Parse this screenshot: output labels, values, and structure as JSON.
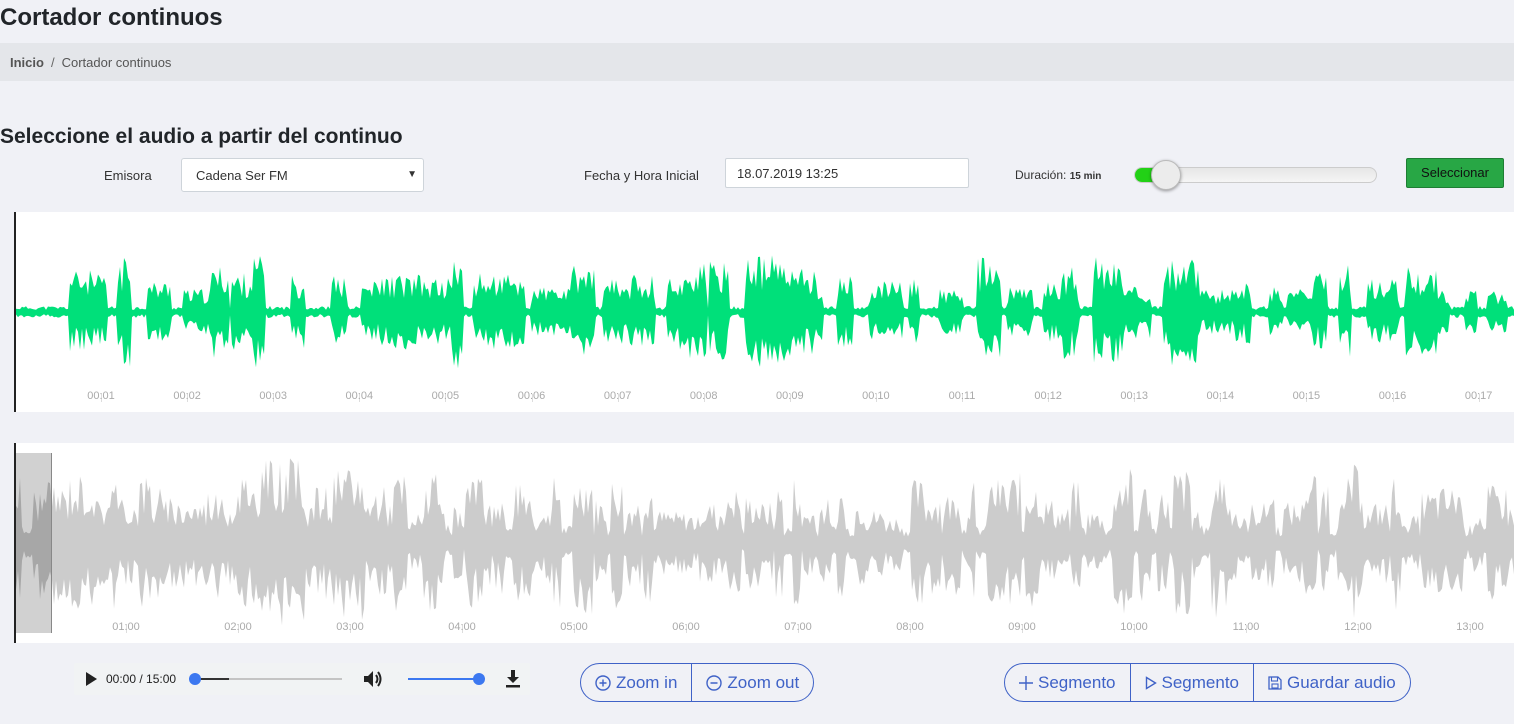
{
  "page": {
    "title": "Cortador continuos"
  },
  "breadcrumb": {
    "home": "Inicio",
    "separator": "/",
    "current": "Cortador continuos"
  },
  "section": {
    "title": "Seleccione el audio a partir del continuo"
  },
  "form": {
    "station_label": "Emisora",
    "station_value": "Cadena Ser FM",
    "datetime_label": "Fecha y Hora Inicial",
    "datetime_value": "18.07.2019 13:25",
    "duration_label": "Duración:",
    "duration_value": "15 min",
    "duration_slider_fraction": 0.13,
    "select_button": "Seleccionar"
  },
  "colors": {
    "accent_green": "#22d116",
    "wave_green": "#00e07a",
    "wave_gray": "#cccccc",
    "button_blue": "#3f62c7",
    "select_button": "#28a745"
  },
  "zoom_waveform": {
    "ticks": [
      "00:01",
      "00:02",
      "00:03",
      "00:04",
      "00:05",
      "00:06",
      "00:07",
      "00:08",
      "00:09",
      "00:10",
      "00:11",
      "00:12",
      "00:13",
      "00:14",
      "00:15",
      "00:16",
      "00:17"
    ]
  },
  "overview_waveform": {
    "ticks": [
      "01:00",
      "02:00",
      "03:00",
      "04:00",
      "05:00",
      "06:00",
      "07:00",
      "08:00",
      "09:00",
      "10:00",
      "11:00",
      "12:00",
      "13:00"
    ]
  },
  "player": {
    "time": "00:00 / 15:00",
    "progress_fraction": 0.0,
    "volume_fraction": 1.0,
    "play_icon": "play-icon",
    "volume_icon": "volume-icon",
    "download_icon": "download-icon"
  },
  "zoom_buttons": {
    "zoom_in": "Zoom in",
    "zoom_out": "Zoom out"
  },
  "segment_buttons": {
    "add_segment": "Segmento",
    "play_segment": "Segmento",
    "save_audio": "Guardar audio"
  }
}
